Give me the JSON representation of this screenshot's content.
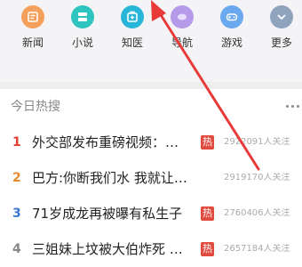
{
  "colors": {
    "accent_red": "#e93a3a",
    "rank_1": "#e33b2f",
    "rank_2": "#e6892a",
    "rank_3": "#3a79d6",
    "rank_4": "#888888",
    "hot_badge": "#e04a3f",
    "arrow": "#e93a3a"
  },
  "quick_nav": [
    {
      "label": "新闻",
      "icon": "news-icon",
      "color": "#f5a05a"
    },
    {
      "label": "小说",
      "icon": "book-icon",
      "color": "#2ec4c0"
    },
    {
      "label": "知医",
      "icon": "medical-icon",
      "color": "#28b6d8"
    },
    {
      "label": "导航",
      "icon": "navigation-icon",
      "color": "#b49ae8"
    },
    {
      "label": "游戏",
      "icon": "gamepad-icon",
      "color": "#6aa8f0"
    },
    {
      "label": "更多",
      "icon": "chevron-down-icon",
      "color": "#8fa3bd"
    }
  ],
  "hot_search": {
    "title": "今日热搜",
    "items": [
      {
        "rank": "1",
        "title": "外交部发布重磅视频：…",
        "hot": "热",
        "followers": "2922091人关注"
      },
      {
        "rank": "2",
        "title": "巴方:你断我们水 我就让…",
        "hot": "",
        "followers": "2919170人关注"
      },
      {
        "rank": "3",
        "title": "71岁成龙再被曝有私生子",
        "hot": "热",
        "followers": "2760406人关注"
      },
      {
        "rank": "4",
        "title": "三姐妹上坟被大伯炸死 …",
        "hot": "热",
        "followers": "2657184人关注"
      }
    ]
  }
}
